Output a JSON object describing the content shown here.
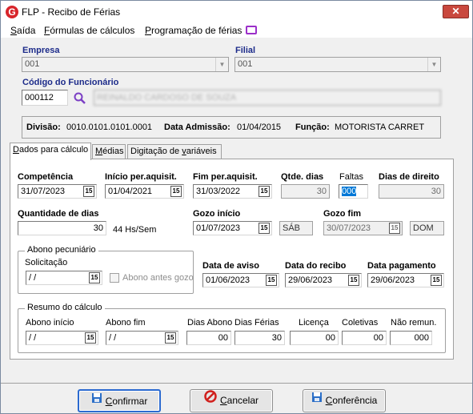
{
  "window": {
    "title": "FLP - Recibo de Férias",
    "close_glyph": "✕"
  },
  "menu": {
    "items": [
      {
        "label": "Saída",
        "ul": "S",
        "rest": "aída"
      },
      {
        "label": "Fórmulas de cálculos",
        "ul": "F",
        "rest": "órmulas de cálculos"
      },
      {
        "label": "Programação de férias",
        "ul": "P",
        "rest": "rogramação de férias"
      }
    ],
    "message_icon": "message-icon"
  },
  "header": {
    "empresa_label": "Empresa",
    "empresa_value": "001",
    "filial_label": "Filial",
    "filial_value": "001",
    "funcionario_label": "Código do Funcionário",
    "funcionario_code": "000112",
    "funcionario_name": "REINALDO CARDOSO DE SOUZA"
  },
  "info": {
    "divisao_label": "Divisão:",
    "divisao_value": "0010.0101.0101.0001",
    "admissao_label": "Data Admissão:",
    "admissao_value": "01/04/2015",
    "funcao_label": "Função:",
    "funcao_value": "MOTORISTA CARRET"
  },
  "tabs": [
    {
      "label": "Dados para cálculo",
      "ul": "D",
      "active": true
    },
    {
      "label": "Médias",
      "ul": "M",
      "active": false
    },
    {
      "label": "Digitação de variáveis",
      "ul": "v",
      "active": false
    }
  ],
  "form": {
    "competencia_label": "Competência",
    "competencia": "31/07/2023",
    "inicio_label": "Início per.aquisit.",
    "inicio": "01/04/2021",
    "fim_label": "Fim per.aquisit.",
    "fim": "31/03/2022",
    "qtde_dias_label": "Qtde. dias",
    "qtde_dias": "30",
    "faltas_label": "Faltas",
    "faltas": "000",
    "dias_direito_label": "Dias de direito",
    "dias_direito": "30",
    "qtd_dias_label": "Quantidade de dias",
    "qtd_dias": "30",
    "hs_sem": "44 Hs/Sem",
    "gozo_inicio_label": "Gozo início",
    "gozo_inicio": "01/07/2023",
    "gozo_inicio_dia": "SÁB",
    "gozo_fim_label": "Gozo fim",
    "gozo_fim": "30/07/2023",
    "gozo_fim_dia": "DOM",
    "abono_group_label": "Abono pecuniário",
    "solicitacao_label": "Solicitação",
    "solicitacao": " / /",
    "abono_antes_label": "Abono antes gozo",
    "aviso_label": "Data de aviso",
    "aviso": "01/06/2023",
    "recibo_label": "Data do recibo",
    "recibo": "29/06/2023",
    "pagamento_label": "Data pagamento",
    "pagamento": "29/06/2023",
    "cal_glyph": "15"
  },
  "resumo": {
    "group_label": "Resumo do cálculo",
    "abono_inicio_label": "Abono início",
    "abono_inicio": " / /",
    "abono_fim_label": "Abono fim",
    "abono_fim": " / /",
    "dias_abono_label": "Dias Abono",
    "dias_abono": "00",
    "dias_ferias_label": "Dias Férias",
    "dias_ferias": "30",
    "licenca_label": "Licença",
    "licenca": "00",
    "coletivas_label": "Coletivas",
    "coletivas": "00",
    "nao_remun_label": "Não remun.",
    "nao_remun": "000"
  },
  "buttons": {
    "confirmar": {
      "ul": "C",
      "rest": "onfirmar"
    },
    "cancelar": {
      "ul": "C",
      "rest": "ancelar"
    },
    "conferencia": {
      "ul": "C",
      "rest": "onferência"
    }
  }
}
